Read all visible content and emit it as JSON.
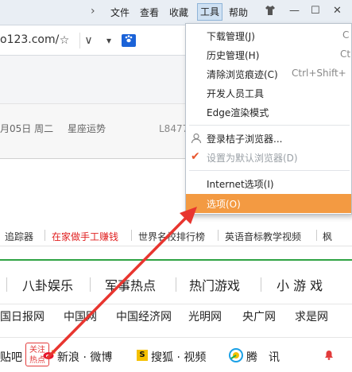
{
  "menubar": {
    "chevron": "›",
    "items": [
      "文件",
      "查看",
      "收藏",
      "工具",
      "帮助"
    ],
    "skin_icon": "shirt-icon",
    "minimize": "—",
    "restore": "☐",
    "close": "✕"
  },
  "addressbar": {
    "url": "o123.com/",
    "star": "☆",
    "dropdown": "∨",
    "search_engine": "🐾"
  },
  "date": {
    "text": "月05日 周二",
    "horoscope": "星座运势",
    "code": "L8477"
  },
  "link_strip": [
    "追踪器",
    "在家做手工赚钱",
    "世界名校排行榜",
    "英语音标教学视频",
    "枫"
  ],
  "categories": [
    "八卦娱乐",
    "军事热点",
    "热门游戏",
    "小 游 戏"
  ],
  "sites": [
    "国日报网",
    "中国网",
    "中国经济网",
    "光明网",
    "央广网",
    "求是网"
  ],
  "bottom": {
    "tieba": "贴吧",
    "hot_badge_line1": "关注",
    "hot_badge_line2": "热点",
    "sina": "新浪 · 微博",
    "sohu_mark": "S",
    "sohu": "搜狐 · 视频",
    "tencent": "腾　讯"
  },
  "dropdown": {
    "items": [
      {
        "label": "下载管理(J)",
        "shortcut": "C"
      },
      {
        "label": "历史管理(H)",
        "shortcut": "Ct"
      },
      {
        "label": "清除浏览痕迹(C)",
        "shortcut": "Ctrl+Shift+"
      },
      {
        "label": "开发人员工具",
        "shortcut": ""
      },
      {
        "label": "Edge渲染模式",
        "shortcut": ""
      },
      {
        "label": "登录桔子浏览器...",
        "shortcut": ""
      },
      {
        "label": "设置为默认浏览器(D)",
        "shortcut": ""
      },
      {
        "label": "Internet选项(I)",
        "shortcut": ""
      },
      {
        "label": "选项(O)",
        "shortcut": ""
      }
    ],
    "highlight_color": "#f39a42"
  },
  "colors": {
    "arrow": "#e8352f",
    "accent_green": "#2fa344",
    "red_link": "#e02020"
  }
}
